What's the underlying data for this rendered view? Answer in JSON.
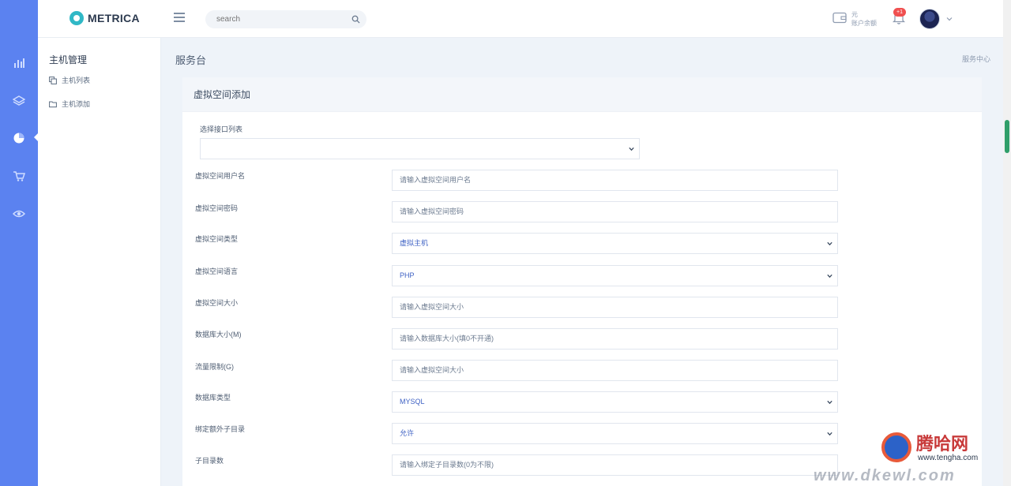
{
  "brand": {
    "name": "METRICA"
  },
  "search": {
    "placeholder": "search"
  },
  "header": {
    "balance_currency": "元",
    "balance_label": "账户余额",
    "notification_count": "+1"
  },
  "rail": {
    "icons": [
      "bar-chart-icon",
      "layers-icon",
      "pie-chart-icon",
      "cart-icon",
      "eye-icon"
    ]
  },
  "subside": {
    "title": "主机管理",
    "items": [
      {
        "label": "主机列表",
        "icon": "copy-icon"
      },
      {
        "label": "主机添加",
        "icon": "folder-icon"
      }
    ]
  },
  "page": {
    "title": "服务台",
    "breadcrumb": "服务中心"
  },
  "form": {
    "card_title": "虚拟空间添加",
    "interface_label": "选择接口列表",
    "interface_value": "",
    "fields": [
      {
        "label": "虚拟空间用户名",
        "placeholder": "请输入虚拟空间用户名",
        "type": "input"
      },
      {
        "label": "虚拟空间密码",
        "placeholder": "请输入虚拟空间密码",
        "type": "input"
      },
      {
        "label": "虚拟空间类型",
        "value": "虚拟主机",
        "type": "select"
      },
      {
        "label": "虚拟空间语言",
        "value": "PHP",
        "type": "select"
      },
      {
        "label": "虚拟空间大小",
        "placeholder": "请输入虚拟空间大小",
        "type": "input"
      },
      {
        "label": "数据库大小(M)",
        "placeholder": "请输入数据库大小(填0不开通)",
        "type": "input"
      },
      {
        "label": "流量限制(G)",
        "placeholder": "请输入虚拟空间大小",
        "type": "input"
      },
      {
        "label": "数据库类型",
        "value": "MYSQL",
        "type": "select"
      },
      {
        "label": "绑定额外子目录",
        "value": "允许",
        "type": "select"
      },
      {
        "label": "子目录数",
        "placeholder": "请输入绑定子目录数(0为不限)",
        "type": "input"
      }
    ]
  },
  "watermark": {
    "brand": "腾哈网",
    "domain": "www.tengha.com",
    "url": "www.dkewl.com"
  }
}
